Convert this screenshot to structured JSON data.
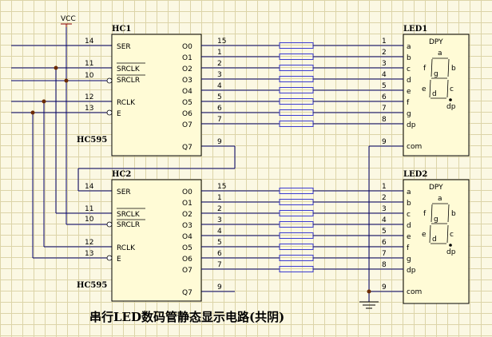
{
  "supply_label": "VCC",
  "caption": "串行LED数码管静态显示电路(共阴)",
  "chips": [
    {
      "name": "HC1",
      "part": "HC595",
      "input_pins": [
        {
          "num": "14",
          "label": "SER"
        },
        {
          "num": "11",
          "label": "SRCLK"
        },
        {
          "num": "10",
          "label": "SRCLR"
        },
        {
          "num": "12",
          "label": "RCLK"
        },
        {
          "num": "13",
          "label": "E"
        }
      ],
      "output_pins": [
        {
          "label": "O0",
          "num": "15"
        },
        {
          "label": "O1",
          "num": "1"
        },
        {
          "label": "O2",
          "num": "2"
        },
        {
          "label": "O3",
          "num": "3"
        },
        {
          "label": "O4",
          "num": "4"
        },
        {
          "label": "O5",
          "num": "5"
        },
        {
          "label": "O6",
          "num": "6"
        },
        {
          "label": "O7",
          "num": "7"
        }
      ],
      "q7": {
        "label": "Q7",
        "num": "9"
      }
    },
    {
      "name": "HC2",
      "part": "HC595",
      "input_pins": [
        {
          "num": "14",
          "label": "SER"
        },
        {
          "num": "11",
          "label": "SRCLK"
        },
        {
          "num": "10",
          "label": "SRCLR"
        },
        {
          "num": "12",
          "label": "RCLK"
        },
        {
          "num": "13",
          "label": "E"
        }
      ],
      "output_pins": [
        {
          "label": "O0",
          "num": "15"
        },
        {
          "label": "O1",
          "num": "1"
        },
        {
          "label": "O2",
          "num": "2"
        },
        {
          "label": "O3",
          "num": "3"
        },
        {
          "label": "O4",
          "num": "4"
        },
        {
          "label": "O5",
          "num": "5"
        },
        {
          "label": "O6",
          "num": "6"
        },
        {
          "label": "O7",
          "num": "7"
        }
      ],
      "q7": {
        "label": "Q7",
        "num": "9"
      }
    }
  ],
  "displays": [
    {
      "name": "LED1",
      "title": "DPY",
      "pins": [
        {
          "num": "1",
          "seg": "a"
        },
        {
          "num": "2",
          "seg": "b"
        },
        {
          "num": "3",
          "seg": "c"
        },
        {
          "num": "4",
          "seg": "d"
        },
        {
          "num": "5",
          "seg": "e"
        },
        {
          "num": "6",
          "seg": "f"
        },
        {
          "num": "7",
          "seg": "g"
        },
        {
          "num": "8",
          "seg": "dp"
        }
      ],
      "com": {
        "num": "9",
        "label": "com"
      },
      "segment_labels": {
        "a": "a",
        "b": "b",
        "c": "c",
        "d": "d",
        "e": "e",
        "f": "f",
        "g": "g",
        "dp": "dp"
      }
    },
    {
      "name": "LED2",
      "title": "DPY",
      "pins": [
        {
          "num": "1",
          "seg": "a"
        },
        {
          "num": "2",
          "seg": "b"
        },
        {
          "num": "3",
          "seg": "c"
        },
        {
          "num": "4",
          "seg": "d"
        },
        {
          "num": "5",
          "seg": "e"
        },
        {
          "num": "6",
          "seg": "f"
        },
        {
          "num": "7",
          "seg": "g"
        },
        {
          "num": "8",
          "seg": "dp"
        }
      ],
      "com": {
        "num": "9",
        "label": "com"
      },
      "segment_labels": {
        "a": "a",
        "b": "b",
        "c": "c",
        "d": "d",
        "e": "e",
        "f": "f",
        "g": "g",
        "dp": "dp"
      }
    }
  ]
}
